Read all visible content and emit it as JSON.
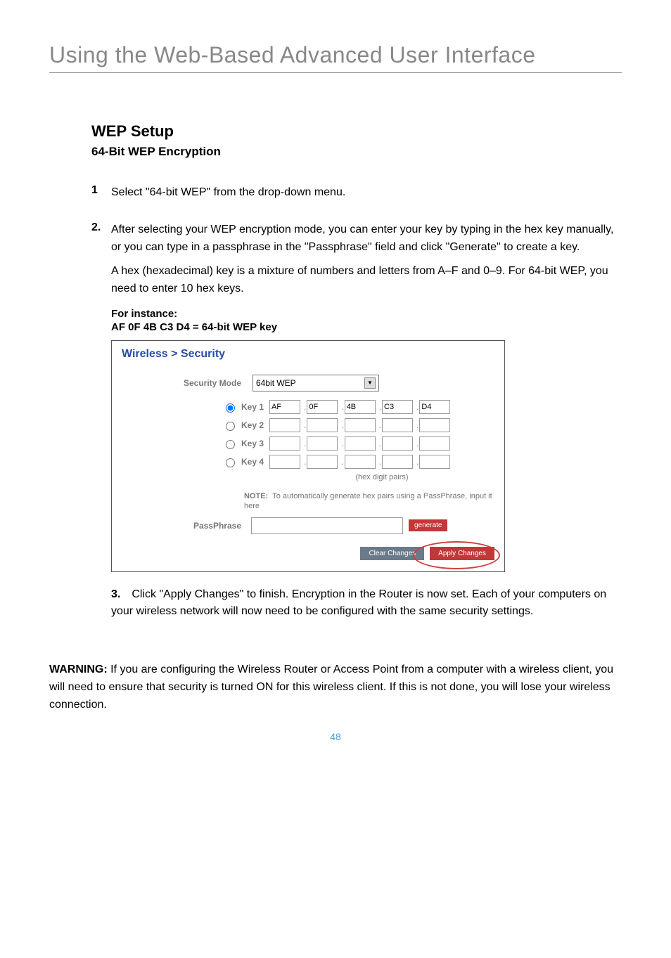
{
  "header": {
    "title": "Using the Web-Based Advanced User Interface"
  },
  "section": {
    "title": "WEP Setup",
    "subtitle": "64-Bit WEP Encryption"
  },
  "steps": {
    "s1": {
      "num": "1",
      "text": "Select \"64-bit WEP\" from the drop-down menu."
    },
    "s2": {
      "num": "2.",
      "text": "After selecting your WEP encryption mode, you can enter your key by typing in the hex key manually, or you can type in a passphrase in the \"Passphrase\" field and click \"Generate\" to create a key.",
      "para2": "A hex (hexadecimal) key is a mixture of numbers and letters from A–F and 0–9. For 64-bit WEP, you need to enter 10 hex keys.",
      "for_instance": "For instance:",
      "for_instance_key": "AF 0F 4B C3 D4 = 64-bit WEP key"
    },
    "s3": {
      "num": "3.",
      "text": "Click \"Apply Changes\" to finish. Encryption in the Router is now set. Each of your computers on your wireless network will now need to be configured with the same security settings."
    }
  },
  "screenshot": {
    "title": "Wireless > Security",
    "security_mode_label": "Security Mode",
    "security_mode_value": "64bit WEP",
    "keys": {
      "k1_label": "Key 1",
      "k2_label": "Key 2",
      "k3_label": "Key 3",
      "k4_label": "Key 4",
      "k1_values": [
        "AF",
        "0F",
        "4B",
        "C3",
        "D4"
      ]
    },
    "hex_hint": "(hex digit pairs)",
    "note_label": "NOTE:",
    "note_text": "To automatically generate hex pairs using a PassPhrase, input it here",
    "passphrase_label": "PassPhrase",
    "generate_btn": "generate",
    "clear_btn": "Clear Changes",
    "apply_btn": "Apply Changes"
  },
  "warning": {
    "label": "WARNING:",
    "text": " If you are configuring the Wireless Router or Access Point from a computer with a wireless client, you will need to ensure that security is turned ON for this wireless client. If this is not done, you will lose your wireless connection."
  },
  "page_number": "48"
}
